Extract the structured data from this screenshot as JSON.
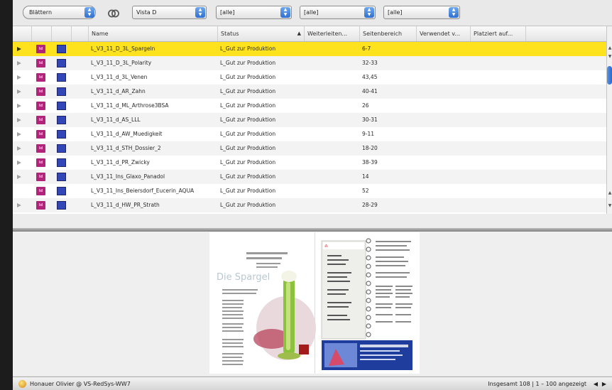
{
  "toolbar": {
    "mode_popup": "Blättern",
    "view_popup": "Vista D",
    "filter1": "[alle]",
    "filter2": "[alle]",
    "filter3": "[alle]"
  },
  "columns": {
    "name": "Name",
    "status": "Status",
    "weiterleiten": "Weiterleiten...",
    "seitenbereich": "Seitenbereich",
    "verwendet": "Verwendet v...",
    "platziert": "Platziert auf..."
  },
  "rows": [
    {
      "name": "L_V3_11_D_3L_Spargeln",
      "status": "L_Gut zur Produktion",
      "pages": "6-7",
      "selected": true,
      "expand": true
    },
    {
      "name": "L_V3_11_D_3L_Polarity",
      "status": "L_Gut zur Produktion",
      "pages": "32-33",
      "expand": true
    },
    {
      "name": "L_V3_11_d_3L_Venen",
      "status": "L_Gut zur Produktion",
      "pages": "43,45",
      "expand": true
    },
    {
      "name": "L_V3_11_d_AR_Zahn",
      "status": "L_Gut zur Produktion",
      "pages": "40-41",
      "expand": true
    },
    {
      "name": "L_V3_11_d_ML_Arthrose3BSA",
      "status": "L_Gut zur Produktion",
      "pages": "26",
      "expand": true
    },
    {
      "name": "L_V3_11_d_AS_LLL",
      "status": "L_Gut zur Produktion",
      "pages": "30-31",
      "expand": true
    },
    {
      "name": "L_V3_11_d_AW_Muedigkeit",
      "status": "L_Gut zur Produktion",
      "pages": "9-11",
      "expand": true
    },
    {
      "name": "L_V3_11_d_STH_Dossier_2",
      "status": "L_Gut zur Produktion",
      "pages": "18-20",
      "expand": true
    },
    {
      "name": "L_V3_11_d_PR_Zwicky",
      "status": "L_Gut zur Produktion",
      "pages": "38-39",
      "expand": true
    },
    {
      "name": "L_V3_11_Ins_Glaxo_Panadol",
      "status": "L_Gut zur Produktion",
      "pages": "14",
      "expand": true
    },
    {
      "name": "L_V3_11_Ins_Beiersdorf_Eucerin_AQUA",
      "status": "L_Gut zur Produktion",
      "pages": "52",
      "expand": false
    },
    {
      "name": "L_V3_11_d_HW_PR_Strath",
      "status": "L_Gut zur Produktion",
      "pages": "28-29",
      "expand": true
    }
  ],
  "preview": {
    "headline": "Die Spargel"
  },
  "statusbar": {
    "user": "Honauer Olivier @ VS-RedSys-WW7",
    "count": "Insgesamt 108 | 1 – 100 angezeigt"
  },
  "colors": {
    "selection": "#fde21d",
    "indd_icon": "#b0247a",
    "page_icon": "#3346b8",
    "accent_blue": "#2f6fd0"
  }
}
